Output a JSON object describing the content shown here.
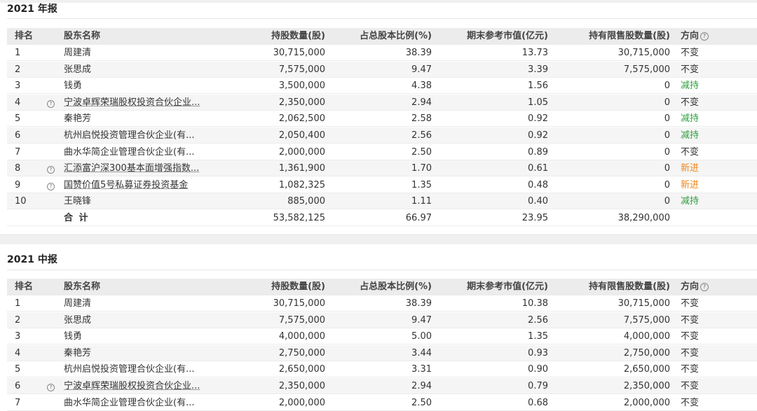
{
  "colors": {
    "reduce": "#2e9e3c",
    "new": "#f0861a",
    "unchanged": "#333333"
  },
  "columns": {
    "rank": "排名",
    "name": "股东名称",
    "shares": "持股数量(股)",
    "ratio": "占总股本比例(%)",
    "market_value": "期末参考市值(亿元)",
    "restricted": "持有限售股数量(股)",
    "direction": "方向"
  },
  "help_icon": "question-circle-icon",
  "annual": {
    "title": "2021 年报",
    "rows": [
      {
        "rank": "1",
        "name": "周建清",
        "shares": "30,715,000",
        "ratio": "38.39",
        "mv": "13.73",
        "restricted": "30,715,000",
        "dir": "不变",
        "info": false
      },
      {
        "rank": "2",
        "name": "张思成",
        "shares": "7,575,000",
        "ratio": "9.47",
        "mv": "3.39",
        "restricted": "7,575,000",
        "dir": "不变",
        "info": false
      },
      {
        "rank": "3",
        "name": "钱勇",
        "shares": "3,500,000",
        "ratio": "4.38",
        "mv": "1.56",
        "restricted": "0",
        "dir": "减持",
        "info": false
      },
      {
        "rank": "4",
        "name": "宁波卓辉荣瑞股权投资合伙企业...",
        "shares": "2,350,000",
        "ratio": "2.94",
        "mv": "1.05",
        "restricted": "0",
        "dir": "不变",
        "info": true
      },
      {
        "rank": "5",
        "name": "秦艳芳",
        "shares": "2,062,500",
        "ratio": "2.58",
        "mv": "0.92",
        "restricted": "0",
        "dir": "减持",
        "info": false
      },
      {
        "rank": "6",
        "name": "杭州启悦投资管理合伙企业(有...",
        "shares": "2,050,400",
        "ratio": "2.56",
        "mv": "0.92",
        "restricted": "0",
        "dir": "减持",
        "info": false
      },
      {
        "rank": "7",
        "name": "曲水华简企业管理合伙企业(有...",
        "shares": "2,000,000",
        "ratio": "2.50",
        "mv": "0.89",
        "restricted": "0",
        "dir": "不变",
        "info": false
      },
      {
        "rank": "8",
        "name": "汇添富沪深300基本面增强指数...",
        "shares": "1,361,900",
        "ratio": "1.70",
        "mv": "0.61",
        "restricted": "0",
        "dir": "新进",
        "info": true
      },
      {
        "rank": "9",
        "name": "国赞价值5号私募证券投资基金",
        "shares": "1,082,325",
        "ratio": "1.35",
        "mv": "0.48",
        "restricted": "0",
        "dir": "新进",
        "info": true
      },
      {
        "rank": "10",
        "name": "王晓锋",
        "shares": "885,000",
        "ratio": "1.11",
        "mv": "0.40",
        "restricted": "0",
        "dir": "减持",
        "info": false
      }
    ],
    "total": {
      "label": "合 计",
      "shares": "53,582,125",
      "ratio": "66.97",
      "mv": "23.95",
      "restricted": "38,290,000"
    }
  },
  "interim": {
    "title": "2021 中报",
    "rows": [
      {
        "rank": "1",
        "name": "周建清",
        "shares": "30,715,000",
        "ratio": "38.39",
        "mv": "10.38",
        "restricted": "30,715,000",
        "dir": "不变",
        "info": false
      },
      {
        "rank": "2",
        "name": "张思成",
        "shares": "7,575,000",
        "ratio": "9.47",
        "mv": "2.56",
        "restricted": "7,575,000",
        "dir": "不变",
        "info": false
      },
      {
        "rank": "3",
        "name": "钱勇",
        "shares": "4,000,000",
        "ratio": "5.00",
        "mv": "1.35",
        "restricted": "4,000,000",
        "dir": "不变",
        "info": false
      },
      {
        "rank": "4",
        "name": "秦艳芳",
        "shares": "2,750,000",
        "ratio": "3.44",
        "mv": "0.93",
        "restricted": "2,750,000",
        "dir": "不变",
        "info": false
      },
      {
        "rank": "5",
        "name": "杭州启悦投资管理合伙企业(有...",
        "shares": "2,650,000",
        "ratio": "3.31",
        "mv": "0.90",
        "restricted": "2,650,000",
        "dir": "不变",
        "info": false
      },
      {
        "rank": "6",
        "name": "宁波卓辉荣瑞股权投资合伙企业...",
        "shares": "2,350,000",
        "ratio": "2.94",
        "mv": "0.79",
        "restricted": "2,350,000",
        "dir": "不变",
        "info": true
      },
      {
        "rank": "7",
        "name": "曲水华简企业管理合伙企业(有...",
        "shares": "2,000,000",
        "ratio": "2.50",
        "mv": "0.68",
        "restricted": "2,000,000",
        "dir": "不变",
        "info": false
      }
    ]
  }
}
